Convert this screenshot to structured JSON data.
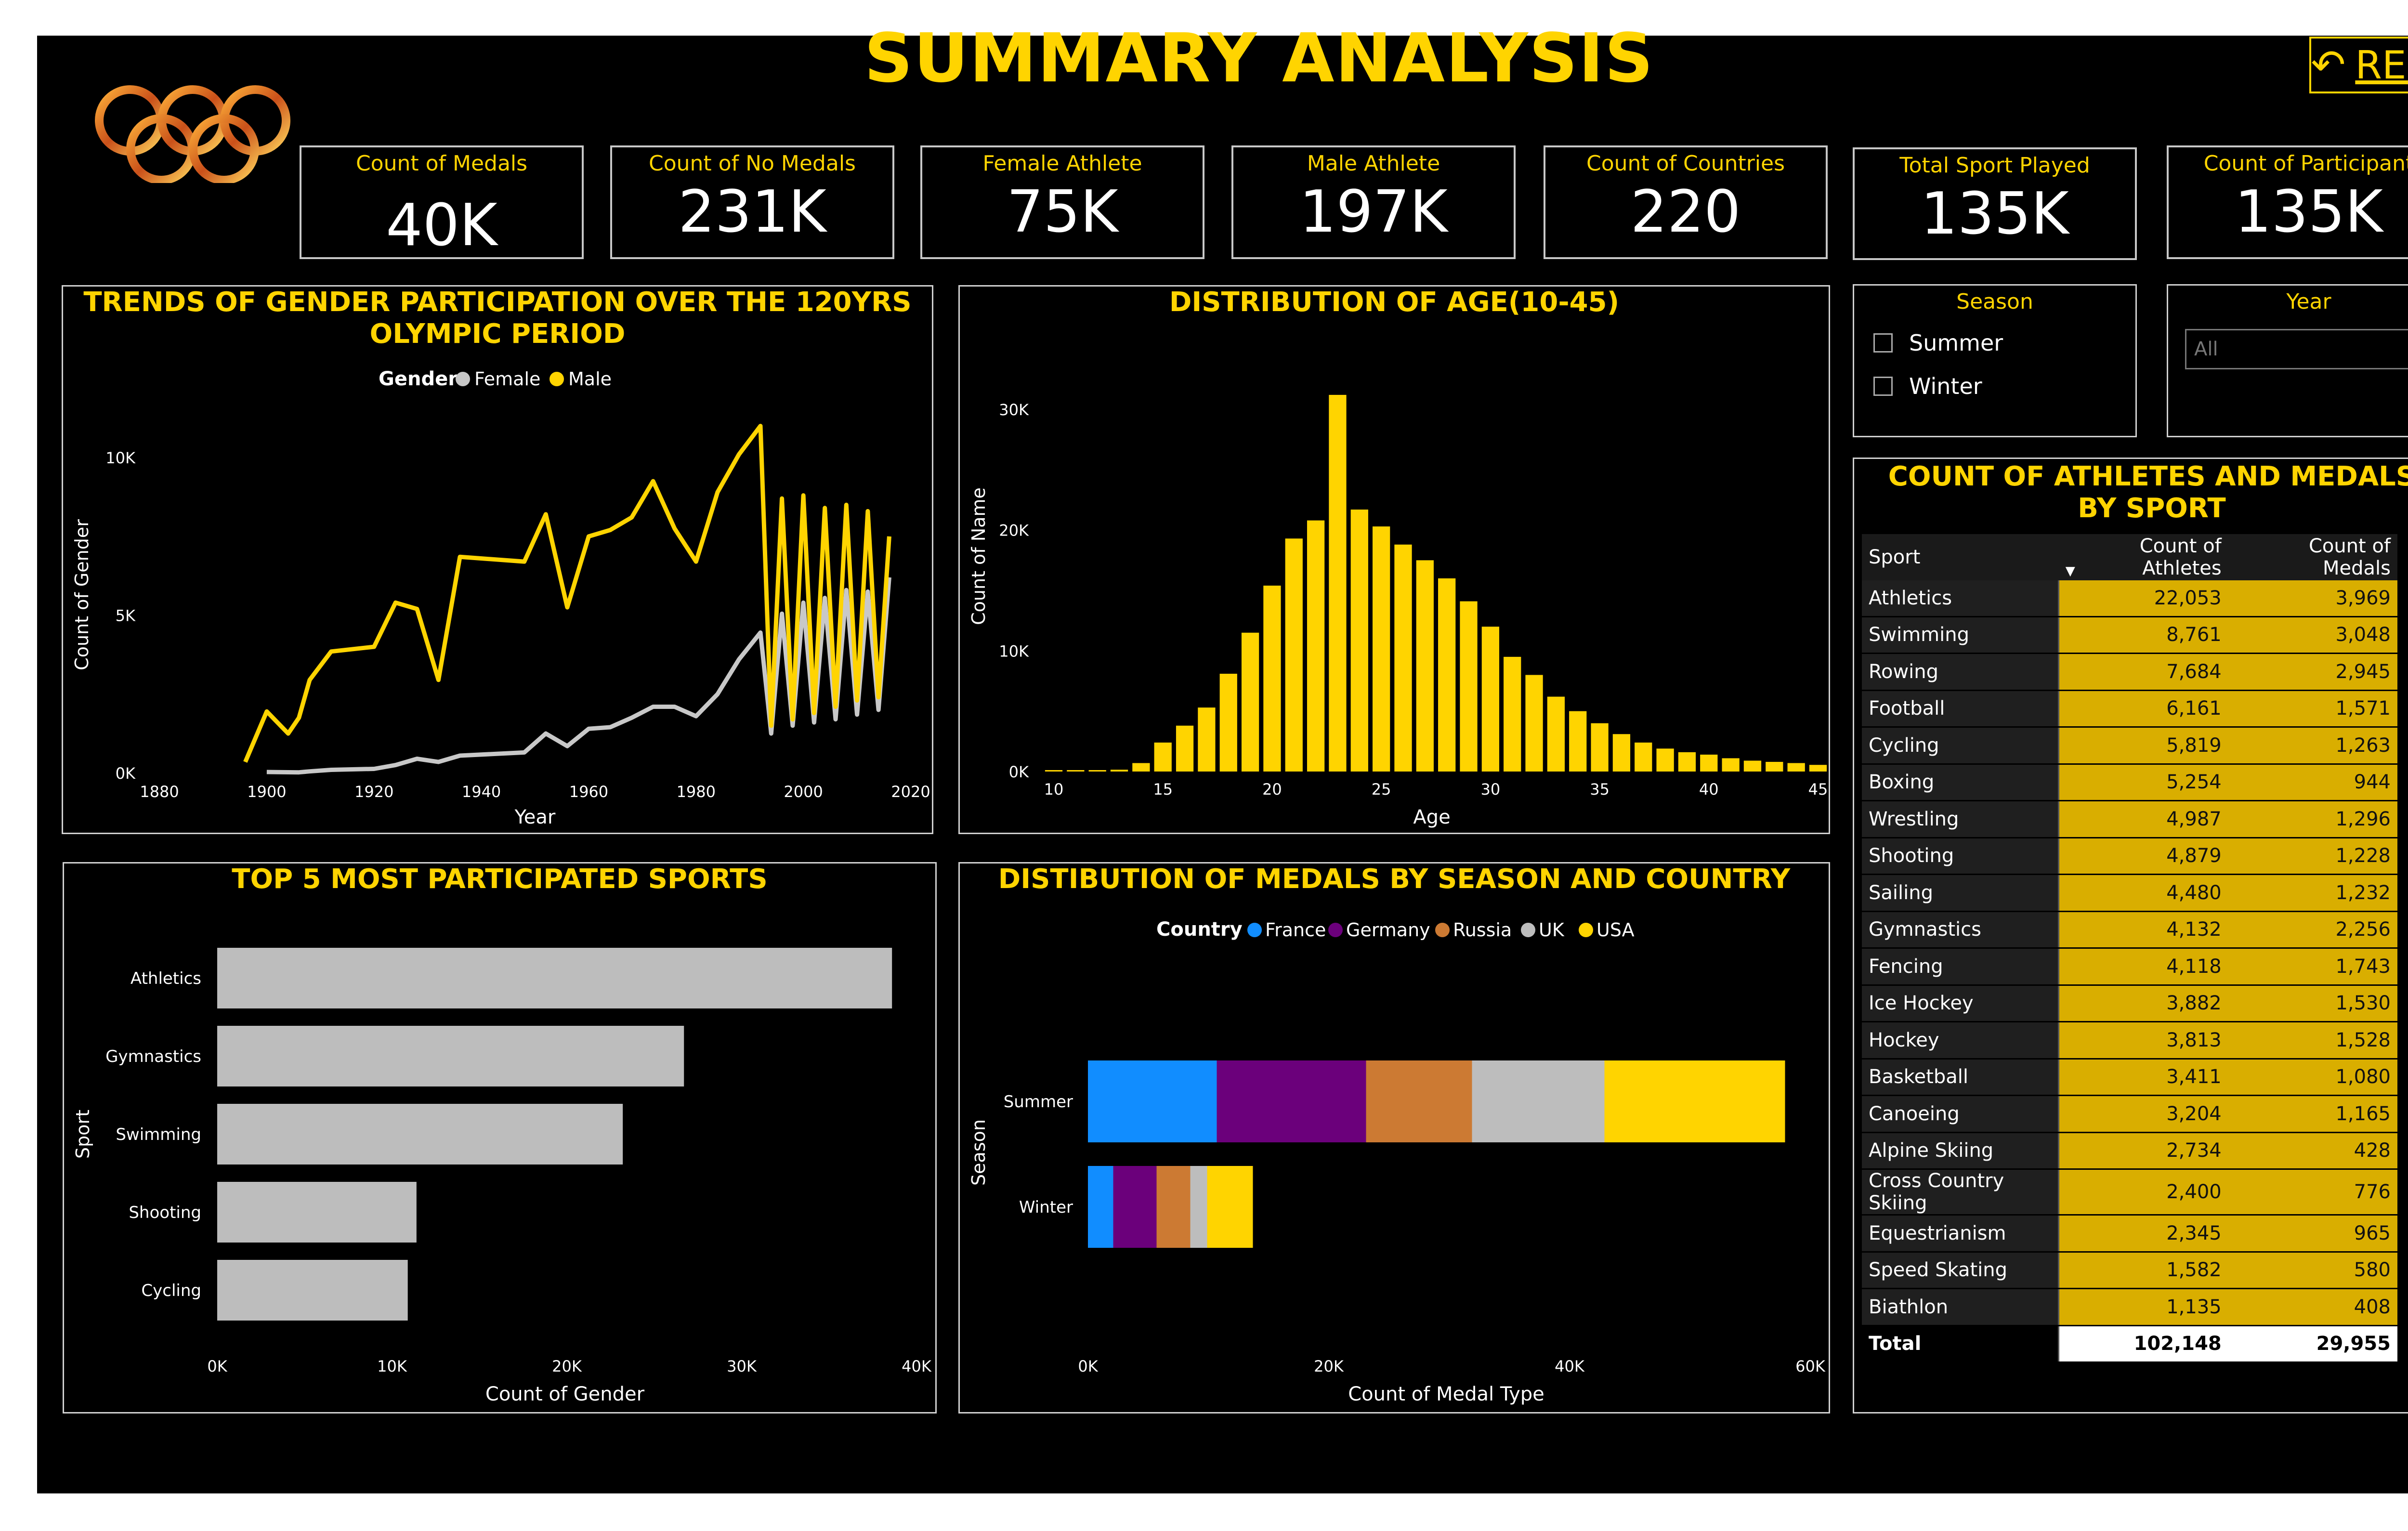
{
  "page": {
    "title": "SUMMARY ANALYSIS",
    "reset_label": "RESET"
  },
  "colors": {
    "accent": "#FFD400",
    "male": "#FFD400",
    "female": "#C8C8C8",
    "bar": "#BDBDBD",
    "France": "#118DFF",
    "Germany": "#6B007B",
    "Russia": "#CC7A33",
    "UK": "#BDBDBD",
    "USA": "#FFD400"
  },
  "kpis": [
    {
      "label": "Count of Medals",
      "value": "40K"
    },
    {
      "label": "Count of No Medals",
      "value": "231K"
    },
    {
      "label": "Female Athlete",
      "value": "75K"
    },
    {
      "label": "Male Athlete",
      "value": "197K"
    },
    {
      "label": "Count of Countries",
      "value": "220"
    },
    {
      "label": "Total Sport Played",
      "value": "135K"
    },
    {
      "label": "Count of Participant",
      "value": "135K"
    }
  ],
  "slicers": {
    "season": {
      "title": "Season",
      "options": [
        "Summer",
        "Winter"
      ]
    },
    "year": {
      "title": "Year",
      "selected": "All"
    }
  },
  "panels": {
    "gender_title": "TRENDS OF GENDER PARTICIPATION OVER THE 120YRS OLYMPIC PERIOD",
    "age_title": "DISTRIBUTION OF AGE(10-45)",
    "top5_title": "TOP 5 MOST PARTICIPATED SPORTS",
    "medals_title": "DISTIBUTION OF MEDALS BY SEASON AND COUNTRY",
    "sport_table_title": "COUNT OF ATHLETES AND MEDALS BY SPORT"
  },
  "chart_data": [
    {
      "id": "gender_trend",
      "type": "line",
      "title": "TRENDS OF GENDER PARTICIPATION OVER THE 120YRS OLYMPIC PERIOD",
      "xlabel": "Year",
      "ylabel": "Count of Gender",
      "legend_title": "Gender",
      "legend_position": "top-center",
      "xlim": [
        1880,
        2020
      ],
      "ylim": [
        0,
        10000
      ],
      "xticks": [
        "1880",
        "1900",
        "1920",
        "1940",
        "1960",
        "1980",
        "2000",
        "2020"
      ],
      "yticks": [
        "0K",
        "5K",
        "10K"
      ],
      "series": [
        {
          "name": "Female",
          "x": [
            1900,
            1906,
            1908,
            1912,
            1920,
            1924,
            1928,
            1932,
            1936,
            1948,
            1952,
            1956,
            1960,
            1964,
            1968,
            1972,
            1976,
            1980,
            1984,
            1988,
            1992,
            1994,
            1996,
            1998,
            2000,
            2002,
            2004,
            2006,
            2008,
            2010,
            2012,
            2014,
            2016
          ],
          "y": [
            30,
            20,
            50,
            100,
            130,
            250,
            450,
            350,
            550,
            650,
            1250,
            850,
            1400,
            1450,
            1750,
            2100,
            2100,
            1800,
            2500,
            3600,
            4450,
            1250,
            5050,
            1500,
            5400,
            1600,
            5550,
            1700,
            5800,
            1850,
            5750,
            2000,
            6200
          ]
        },
        {
          "name": "Male",
          "x": [
            1896,
            1900,
            1904,
            1906,
            1908,
            1912,
            1920,
            1924,
            1928,
            1932,
            1936,
            1948,
            1952,
            1956,
            1960,
            1964,
            1968,
            1972,
            1976,
            1980,
            1984,
            1988,
            1992,
            1994,
            1996,
            1998,
            2000,
            2002,
            2004,
            2006,
            2008,
            2010,
            2012,
            2014,
            2016
          ],
          "y": [
            350,
            1950,
            1250,
            1750,
            2950,
            3850,
            4000,
            5400,
            5200,
            2950,
            6850,
            6700,
            8200,
            5250,
            7500,
            7700,
            8100,
            9250,
            7750,
            6700,
            8900,
            10100,
            11000,
            1500,
            8700,
            1700,
            8800,
            1900,
            8400,
            2100,
            8500,
            2300,
            8300,
            2400,
            7500
          ]
        }
      ]
    },
    {
      "id": "age_distribution",
      "type": "bar",
      "title": "DISTRIBUTION OF AGE(10-45)",
      "xlabel": "Age",
      "ylabel": "Count of Name",
      "xlim": [
        10,
        45
      ],
      "ylim": [
        0,
        30000
      ],
      "xticks": [
        "10",
        "15",
        "20",
        "25",
        "30",
        "35",
        "40",
        "45"
      ],
      "yticks": [
        "0K",
        "10K",
        "20K",
        "30K"
      ],
      "categories": [
        10,
        11,
        12,
        13,
        14,
        15,
        16,
        17,
        18,
        19,
        20,
        21,
        22,
        23,
        24,
        25,
        26,
        27,
        28,
        29,
        30,
        31,
        32,
        33,
        34,
        35,
        36,
        37,
        38,
        39,
        40,
        41,
        42,
        43,
        44,
        45
      ],
      "values": [
        50,
        80,
        100,
        150,
        700,
        2400,
        3800,
        5300,
        8100,
        11500,
        15400,
        19300,
        20800,
        31200,
        21700,
        20300,
        18800,
        17500,
        16000,
        14100,
        12000,
        9500,
        8000,
        6200,
        5000,
        4000,
        3100,
        2400,
        1900,
        1600,
        1400,
        1100,
        900,
        800,
        700,
        550
      ]
    },
    {
      "id": "top5_sports",
      "type": "bar",
      "orientation": "horizontal",
      "title": "TOP 5 MOST PARTICIPATED SPORTS",
      "xlabel": "Count of Gender",
      "ylabel": "Sport",
      "xlim": [
        0,
        40000
      ],
      "xticks": [
        "0K",
        "10K",
        "20K",
        "30K",
        "40K"
      ],
      "categories": [
        "Athletics",
        "Gymnastics",
        "Swimming",
        "Shooting",
        "Cycling"
      ],
      "values": [
        38600,
        26700,
        23200,
        11400,
        10900
      ]
    },
    {
      "id": "medals_season_country",
      "type": "bar",
      "orientation": "horizontal",
      "stacked": true,
      "title": "DISTIBUTION OF MEDALS BY SEASON AND COUNTRY",
      "xlabel": "Count of Medal Type",
      "ylabel": "Season",
      "legend_title": "Country",
      "legend_position": "top-center",
      "xlim": [
        0,
        60000
      ],
      "xticks": [
        "0K",
        "20K",
        "40K",
        "60K"
      ],
      "categories": [
        "Summer",
        "Winter"
      ],
      "series": [
        {
          "name": "France",
          "values": [
            10700,
            2100
          ]
        },
        {
          "name": "Germany",
          "values": [
            12400,
            3600
          ]
        },
        {
          "name": "Russia",
          "values": [
            8800,
            2800
          ]
        },
        {
          "name": "UK",
          "values": [
            11000,
            1400
          ]
        },
        {
          "name": "USA",
          "values": [
            15000,
            3800
          ]
        }
      ]
    },
    {
      "id": "sport_table",
      "type": "table",
      "title": "COUNT OF ATHLETES AND MEDALS BY SPORT",
      "columns": [
        "Sport",
        "Count of Athletes",
        "Count of Medals"
      ],
      "rows": [
        [
          "Athletics",
          "22,053",
          "3,969"
        ],
        [
          "Swimming",
          "8,761",
          "3,048"
        ],
        [
          "Rowing",
          "7,684",
          "2,945"
        ],
        [
          "Football",
          "6,161",
          "1,571"
        ],
        [
          "Cycling",
          "5,819",
          "1,263"
        ],
        [
          "Boxing",
          "5,254",
          "944"
        ],
        [
          "Wrestling",
          "4,987",
          "1,296"
        ],
        [
          "Shooting",
          "4,879",
          "1,228"
        ],
        [
          "Sailing",
          "4,480",
          "1,232"
        ],
        [
          "Gymnastics",
          "4,132",
          "2,256"
        ],
        [
          "Fencing",
          "4,118",
          "1,743"
        ],
        [
          "Ice Hockey",
          "3,882",
          "1,530"
        ],
        [
          "Hockey",
          "3,813",
          "1,528"
        ],
        [
          "Basketball",
          "3,411",
          "1,080"
        ],
        [
          "Canoeing",
          "3,204",
          "1,165"
        ],
        [
          "Alpine Skiing",
          "2,734",
          "428"
        ],
        [
          "Cross Country Skiing",
          "2,400",
          "776"
        ],
        [
          "Equestrianism",
          "2,345",
          "965"
        ],
        [
          "Speed Skating",
          "1,582",
          "580"
        ],
        [
          "Biathlon",
          "1,135",
          "408"
        ]
      ],
      "total": [
        "Total",
        "102,148",
        "29,955"
      ]
    }
  ]
}
